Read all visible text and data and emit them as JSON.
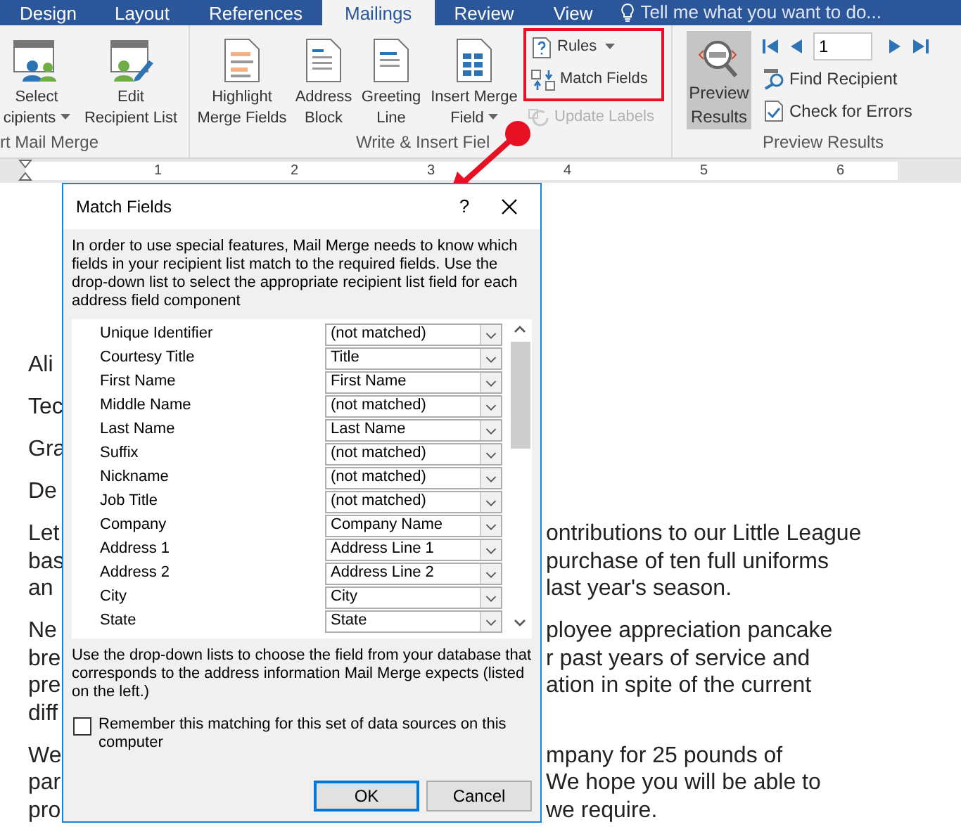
{
  "tabs": [
    {
      "label": "Design",
      "selected": false
    },
    {
      "label": "Layout",
      "selected": false
    },
    {
      "label": "References",
      "selected": false
    },
    {
      "label": "Mailings",
      "selected": true
    },
    {
      "label": "Review",
      "selected": false
    },
    {
      "label": "View",
      "selected": false
    }
  ],
  "tell_me": {
    "placeholder": "Tell me what you want to do..."
  },
  "ribbon": {
    "start_group": {
      "label": "rt Mail Merge",
      "buttons": [
        {
          "lines": [
            "Select",
            "cipients"
          ],
          "dropdown": true
        },
        {
          "lines": [
            "Edit",
            "Recipient List"
          ],
          "dropdown": false
        }
      ]
    },
    "write_group": {
      "label": "Write & Insert Fiel",
      "buttons": [
        {
          "lines": [
            "Highlight",
            "Merge Fields"
          ],
          "dropdown": false
        },
        {
          "lines": [
            "Address",
            "Block"
          ],
          "dropdown": false
        },
        {
          "lines": [
            "Greeting",
            "Line"
          ],
          "dropdown": false
        },
        {
          "lines": [
            "Insert Merge",
            "Field"
          ],
          "dropdown": true
        }
      ],
      "small_buttons": [
        {
          "label": "Rules",
          "dropdown": true,
          "disabled": false
        },
        {
          "label": "Match Fields",
          "dropdown": false,
          "disabled": false
        },
        {
          "label": "Update Labels",
          "dropdown": false,
          "disabled": true
        }
      ]
    },
    "preview_group": {
      "label": "Preview Results",
      "preview_button": {
        "lines": [
          "Preview",
          "Results"
        ],
        "selected": true
      },
      "record": {
        "value": "1"
      },
      "links": [
        "Find Recipient",
        "Check for Errors"
      ]
    }
  },
  "ruler": {
    "labels": [
      "1",
      "2",
      "3",
      "4",
      "5",
      "6"
    ]
  },
  "document": {
    "paragraphs": [
      {
        "lines": [
          {
            "left": "Ali"
          }
        ]
      },
      {
        "lines": [
          {
            "left": "Tec"
          }
        ]
      },
      {
        "lines": [
          {
            "left": "Gra"
          }
        ]
      },
      {
        "lines": [
          {
            "left": "De"
          }
        ]
      },
      {
        "lines": [
          {
            "left": "Let",
            "right": "ontributions to our Little League"
          },
          {
            "left": "bas",
            "right": "purchase of ten full uniforms"
          },
          {
            "left": "an",
            "right": "last year's season."
          }
        ]
      },
      {
        "lines": [
          {
            "left": "Ne",
            "right": "ployee appreciation pancake"
          },
          {
            "left": "bre",
            "right": "r past years of service and"
          },
          {
            "left": "pre",
            "right": "ation in spite of the current"
          },
          {
            "left": "diff"
          }
        ]
      },
      {
        "lines": [
          {
            "left": "We",
            "right": "mpany for 25 pounds of"
          },
          {
            "left": "par",
            "right": "We hope you will be able to"
          },
          {
            "left": "pro",
            "right": "we require."
          }
        ]
      }
    ]
  },
  "dialog": {
    "title": "Match Fields",
    "help": "?",
    "intro": "In order to use special features, Mail Merge needs to know which fields in your recipient list match to the required fields. Use the drop-down list to select the appropriate recipient list field for each address field component",
    "fields": [
      {
        "label": "Unique Identifier",
        "value": "(not matched)"
      },
      {
        "label": "Courtesy Title",
        "value": "Title"
      },
      {
        "label": "First Name",
        "value": "First Name"
      },
      {
        "label": "Middle Name",
        "value": "(not matched)"
      },
      {
        "label": "Last Name",
        "value": "Last Name"
      },
      {
        "label": "Suffix",
        "value": "(not matched)"
      },
      {
        "label": "Nickname",
        "value": "(not matched)"
      },
      {
        "label": "Job Title",
        "value": "(not matched)"
      },
      {
        "label": "Company",
        "value": "Company Name"
      },
      {
        "label": "Address 1",
        "value": "Address Line 1"
      },
      {
        "label": "Address 2",
        "value": "Address Line 2"
      },
      {
        "label": "City",
        "value": "City"
      },
      {
        "label": "State",
        "value": "State"
      }
    ],
    "footer": "Use the drop-down lists to choose the field from your database that corresponds to the address information Mail Merge expects (listed on the left.)",
    "remember": {
      "label": "Remember this matching for this set of data sources on this computer",
      "checked": false
    },
    "buttons": [
      {
        "label": "OK",
        "default": true
      },
      {
        "label": "Cancel",
        "default": false
      }
    ]
  }
}
